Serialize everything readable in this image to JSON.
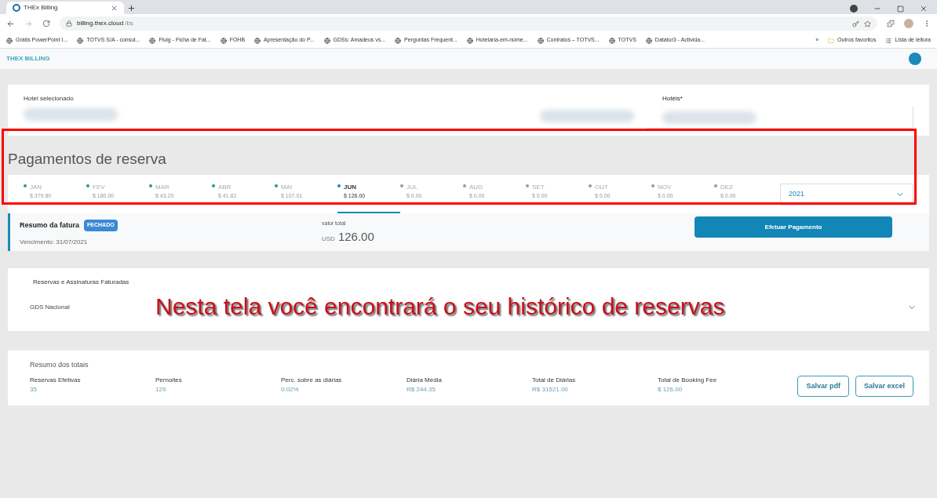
{
  "browser": {
    "tab_title": "THEx Billing",
    "url_host": "billing.thex.cloud",
    "url_path": "/bs",
    "bookmarks": [
      "Grátis PowerPoint I...",
      "TOTVS S/A - consul...",
      "Fluig - Ficha de Fat...",
      "FOHB",
      "Apresentação do P...",
      "GDSs: Amadeus vs...",
      "Perguntas Frequent...",
      "Hotelaria-em-núme...",
      "Contratos – TOTVS...",
      "TOTVS",
      "Datatur3 - Activida..."
    ],
    "more": "»",
    "other_bookmarks": "Outros favoritos",
    "reading_list": "Lista de leitura"
  },
  "app": {
    "brand": "THEX BILLING"
  },
  "hotel": {
    "label": "Hotel selecionado",
    "hotels_label": "Hotéis*"
  },
  "payments": {
    "title": "Pagamentos de reserva",
    "year": "2021",
    "months": [
      {
        "name": "JAN",
        "amount": "$ 379.80",
        "color": "#1aa08a",
        "selected": false
      },
      {
        "name": "FEV",
        "amount": "$ 180.00",
        "color": "#1aa08a",
        "selected": false
      },
      {
        "name": "MAR",
        "amount": "$ 43.20",
        "color": "#1aa08a",
        "selected": false
      },
      {
        "name": "ABR",
        "amount": "$ 41.82",
        "color": "#1aa08a",
        "selected": false
      },
      {
        "name": "MAI",
        "amount": "$ 107.01",
        "color": "#1aa08a",
        "selected": false
      },
      {
        "name": "JUN",
        "amount": "$ 126.00",
        "color": "#1a8ab8",
        "selected": true
      },
      {
        "name": "JUL",
        "amount": "$ 0.00",
        "color": "#9a9a9a",
        "selected": false
      },
      {
        "name": "AUG",
        "amount": "$ 0.00",
        "color": "#9a9a9a",
        "selected": false
      },
      {
        "name": "SET",
        "amount": "$ 0.00",
        "color": "#9a9a9a",
        "selected": false
      },
      {
        "name": "OUT",
        "amount": "$ 0.00",
        "color": "#9a9a9a",
        "selected": false
      },
      {
        "name": "NOV",
        "amount": "$ 0.00",
        "color": "#9a9a9a",
        "selected": false
      },
      {
        "name": "DEZ",
        "amount": "$ 0.00",
        "color": "#9a9a9a",
        "selected": false
      }
    ]
  },
  "invoice": {
    "title": "Resumo da fatura",
    "badge": "FECHADO",
    "due": "Vencimento: 31/07/2021",
    "total_label": "valor total",
    "currency": "USD",
    "total": "126.00",
    "pay_button": "Efetuar Pagamento"
  },
  "reservations": {
    "title": "Reservas e Assinaturas Faturadas",
    "group": "GDS Nacional"
  },
  "caption": "Nesta tela você encontrará o seu histórico de reservas",
  "totals": {
    "title": "Resumo dos totais",
    "items": [
      {
        "label": "Reservas Efetivas",
        "value": "35"
      },
      {
        "label": "Pernoites",
        "value": "129"
      },
      {
        "label": "Perc. sobre as diárias",
        "value": "0.02%"
      },
      {
        "label": "Diária Média",
        "value": "R$ 244.35"
      },
      {
        "label": "Total de Diárias",
        "value": "R$ 31521.00"
      },
      {
        "label": "Total de Booking Fee",
        "value": "$ 126.00"
      }
    ],
    "buttons": [
      "Salvar pdf",
      "Salvar excel"
    ]
  }
}
